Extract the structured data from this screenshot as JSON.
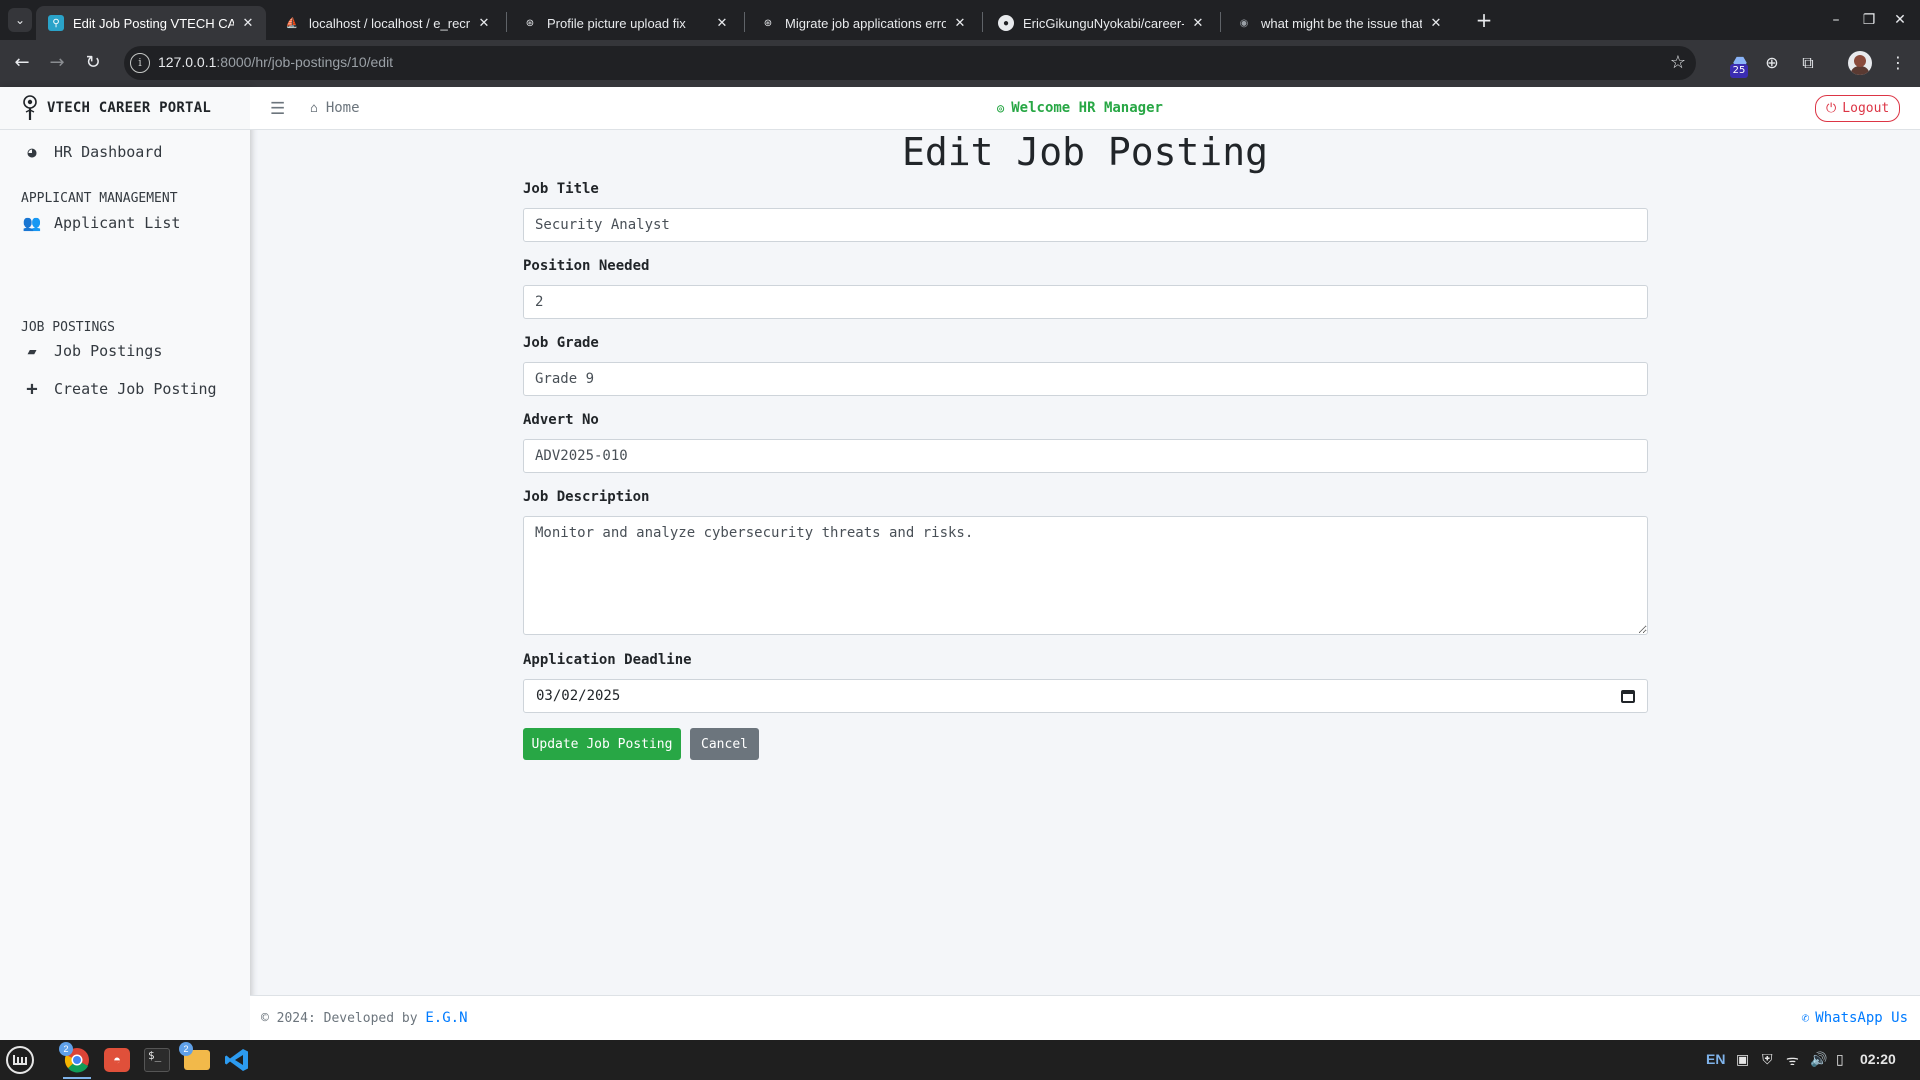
{
  "browser": {
    "tabs": [
      {
        "title": "Edit Job Posting VTECH CAREER PORTAL",
        "active": true
      },
      {
        "title": "localhost / localhost / e_recruitment",
        "active": false
      },
      {
        "title": "Profile picture upload fix",
        "active": false
      },
      {
        "title": "Migrate job applications error",
        "active": false
      },
      {
        "title": "EricGikunguNyokabi/career-portal",
        "active": false
      },
      {
        "title": "what might be the issue that",
        "active": false
      }
    ],
    "url_host": "127.0.0.1",
    "url_rest": ":8000/hr/job-postings/10/edit",
    "extension_badge": "25"
  },
  "app": {
    "brand": "VTECH CAREER PORTAL",
    "sidebar": {
      "dashboard": "HR Dashboard",
      "section_applicants": "APPLICANT MANAGEMENT",
      "applicant_list": "Applicant List",
      "section_jobs": "JOB POSTINGS",
      "job_postings": "Job Postings",
      "create_job_posting": "Create Job Posting"
    },
    "navbar": {
      "home": "Home",
      "welcome": "Welcome HR Manager",
      "logout": "Logout"
    }
  },
  "form": {
    "title": "Edit Job Posting",
    "job_title_label": "Job Title",
    "job_title_value": "Security Analyst",
    "position_label": "Position Needed",
    "position_value": "2",
    "grade_label": "Job Grade",
    "grade_value": "Grade 9",
    "advert_label": "Advert No",
    "advert_value": "ADV2025-010",
    "description_label": "Job Description",
    "description_value": "Monitor and analyze cybersecurity threats and risks.",
    "deadline_label": "Application Deadline",
    "deadline_value": "03/02/2025",
    "submit_label": "Update Job Posting",
    "cancel_label": "Cancel"
  },
  "footer": {
    "copyright": "© 2024: Developed by ",
    "developer": "E.G.N",
    "whatsapp": "WhatsApp Us"
  },
  "taskbar": {
    "chrome_count": "2",
    "files_count": "2",
    "language": "EN",
    "clock": "02:20"
  },
  "colors": {
    "success": "#28a745",
    "danger": "#dc3545",
    "secondary": "#6c757d",
    "link": "#007bff"
  }
}
